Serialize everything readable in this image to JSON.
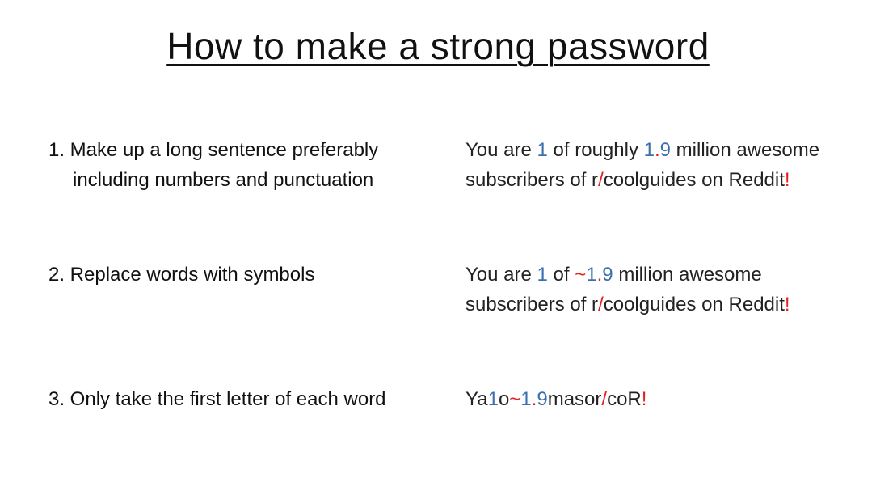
{
  "title": "How to make a strong password",
  "colors": {
    "highlight_number": "#3b6fb0",
    "highlight_symbol": "#e5201e"
  },
  "steps": [
    {
      "label": "1. Make up a long sentence preferably including numbers and punctuation",
      "example": [
        {
          "t": "You are ",
          "c": ""
        },
        {
          "t": "1",
          "c": "blue"
        },
        {
          "t": " of roughly ",
          "c": ""
        },
        {
          "t": "1",
          "c": "blue"
        },
        {
          "t": ".",
          "c": "red"
        },
        {
          "t": "9",
          "c": "blue"
        },
        {
          "t": " million awesome subscribers of r",
          "c": ""
        },
        {
          "t": "/",
          "c": "red"
        },
        {
          "t": "coolguides on Reddit",
          "c": ""
        },
        {
          "t": "!",
          "c": "red"
        }
      ]
    },
    {
      "label": "2. Replace words with symbols",
      "example": [
        {
          "t": "You are ",
          "c": ""
        },
        {
          "t": "1",
          "c": "blue"
        },
        {
          "t": " of ",
          "c": ""
        },
        {
          "t": "~",
          "c": "red"
        },
        {
          "t": "1",
          "c": "blue"
        },
        {
          "t": ".",
          "c": "red"
        },
        {
          "t": "9",
          "c": "blue"
        },
        {
          "t": " million awesome subscribers of r",
          "c": ""
        },
        {
          "t": "/",
          "c": "red"
        },
        {
          "t": "coolguides on Reddit",
          "c": ""
        },
        {
          "t": "!",
          "c": "red"
        }
      ]
    },
    {
      "label": "3. Only take the first letter of each word",
      "example": [
        {
          "t": "Ya",
          "c": ""
        },
        {
          "t": "1",
          "c": "blue"
        },
        {
          "t": "o",
          "c": ""
        },
        {
          "t": "~",
          "c": "red"
        },
        {
          "t": "1",
          "c": "blue"
        },
        {
          "t": ".",
          "c": "red"
        },
        {
          "t": "9",
          "c": "blue"
        },
        {
          "t": "masor",
          "c": ""
        },
        {
          "t": "/",
          "c": "red"
        },
        {
          "t": "coR",
          "c": ""
        },
        {
          "t": "!",
          "c": "red"
        }
      ]
    }
  ]
}
